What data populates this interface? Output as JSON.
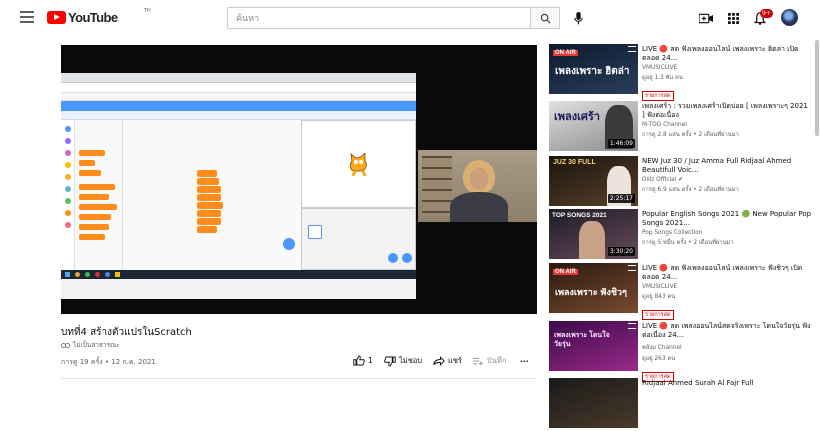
{
  "header": {
    "logo_text": "YouTube",
    "logo_sup": "TH",
    "search_placeholder": "ค้นหา",
    "notification_count": "9+"
  },
  "player": {
    "title": "บทที่4 สร้างตัวแปรในScratch",
    "channel_tag": "ไม่เป็นสาธารณะ",
    "meta": "การดู 19 ครั้ง • 12 ก.ค. 2021",
    "like_count": "1",
    "dislike_label": "ไม่ชอบ",
    "share_label": "แชร์",
    "save_label": "บันทึก",
    "more_label": "..."
  },
  "recommendations": [
    {
      "title": "LIVE 🔴 สด ฟังเพลงออนไลน์ เพลงเพราะ ฮิตล่า เปิดตลอด 24...",
      "channel": "VMUSICLIVE",
      "stats": "ดูอยู่ 1.3 พัน คน",
      "badge": "รายการสด",
      "thumb_text": "เพลงเพราะ ฮิตล่า",
      "is_live": true,
      "thumb_colors": [
        "#0c1a2e",
        "#2a3d5a"
      ]
    },
    {
      "title": "เพลงเศร้า : รวมเพลงเศร้าเปิดบ่อย [ เพลงเพราะๆ 2021 ] ฟังต่อเนื่อง",
      "channel": "M-TOO Channel",
      "stats": "การดู 2.8 แสน ครั้ง • 2 เดือนที่ผ่านมา",
      "duration": "1:46:09",
      "thumb_text": "เพลงเศร้า",
      "is_live": false,
      "thumb_colors": [
        "#d8d8d8",
        "#8a8a8a"
      ]
    },
    {
      "title": "NEW Juz 30 / Juz Amma Full Ridjaal Ahmed Beautifull Voic...",
      "channel": "Diliz Official ✔",
      "stats": "การดู 6.9 แสน ครั้ง • 2 เดือนที่ผ่านมา",
      "duration": "2:25:17",
      "thumb_text": "JUZ 30 FULL",
      "is_live": false,
      "thumb_colors": [
        "#1a1410",
        "#5a4028"
      ]
    },
    {
      "title": "Popular English Songs 2021 🟢 New Popular Pop Songs 2021...",
      "channel": "Pop Songs Collection",
      "stats": "การดู 5 หมื่น ครั้ง • 2 เดือนที่ผ่านมา",
      "duration": "3:30:20",
      "thumb_text": "TOP SONGS 2021",
      "is_live": false,
      "thumb_colors": [
        "#1c1c28",
        "#6a4a5a"
      ]
    },
    {
      "title": "LIVE 🔴 สด ฟังเพลงออนไลน์ เพลงเพราะ ฟังชิวๆ เปิดตลอด 24...",
      "channel": "VMUSICLIVE",
      "stats": "ดูอยู่ 843 คน",
      "badge": "รายการสด",
      "thumb_text": "เพลงเพราะ ฟังชิวๆ",
      "is_live": true,
      "thumb_colors": [
        "#2a1a10",
        "#7a4a30"
      ]
    },
    {
      "title": "LIVE 🔴 สด เพลงออนไลน์สดจริงเพราะ โดนใจวัยรุ่น ฟังต่อเนื่อง 24...",
      "channel": "พลังม Channel",
      "stats": "ดูอยู่ 263 คน",
      "badge": "รายการสด",
      "thumb_text": "เพลงเพราะ โดนใจวัยรุ่น",
      "is_live": true,
      "thumb_colors": [
        "#3a0a4a",
        "#9a2a8a"
      ]
    },
    {
      "title": "Ridjaal Ahmed Surah Al Fajr Full",
      "channel": "",
      "stats": "",
      "thumb_text": "",
      "is_live": false,
      "thumb_colors": [
        "#1a1a1a",
        "#4a3a2a"
      ]
    }
  ]
}
